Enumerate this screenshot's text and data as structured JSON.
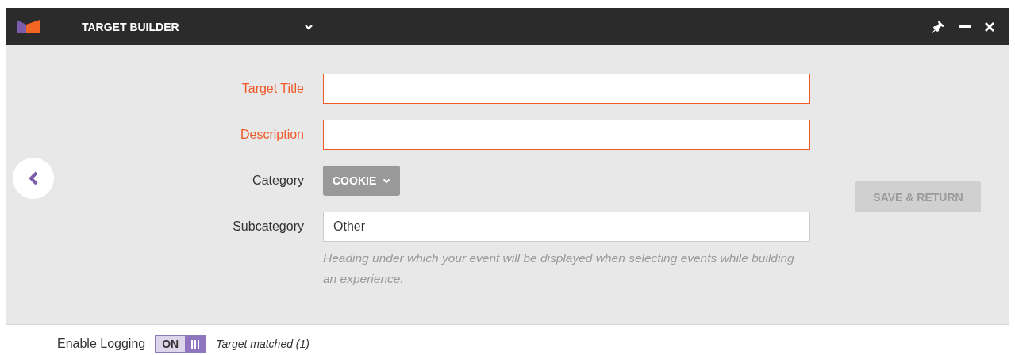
{
  "window": {
    "title": "TARGET BUILDER"
  },
  "form": {
    "fields": [
      {
        "kind": "text",
        "label": "Target Title",
        "invalid": true
      },
      {
        "kind": "text",
        "label": "Description",
        "invalid": true
      },
      {
        "kind": "dropdown",
        "label": "Category",
        "value": "COOKIE",
        "invalid": false
      },
      {
        "kind": "text",
        "label": "Subcategory",
        "value": "Other",
        "invalid": false,
        "hint": "Heading under which your event will be displayed when selecting events while building an experience."
      }
    ]
  },
  "save_button": {
    "label": "SAVE & RETURN",
    "disabled": true
  },
  "logging": {
    "label": "Enable Logging",
    "on": true,
    "toggle_label": "ON",
    "status": "Target matched (1)"
  }
}
